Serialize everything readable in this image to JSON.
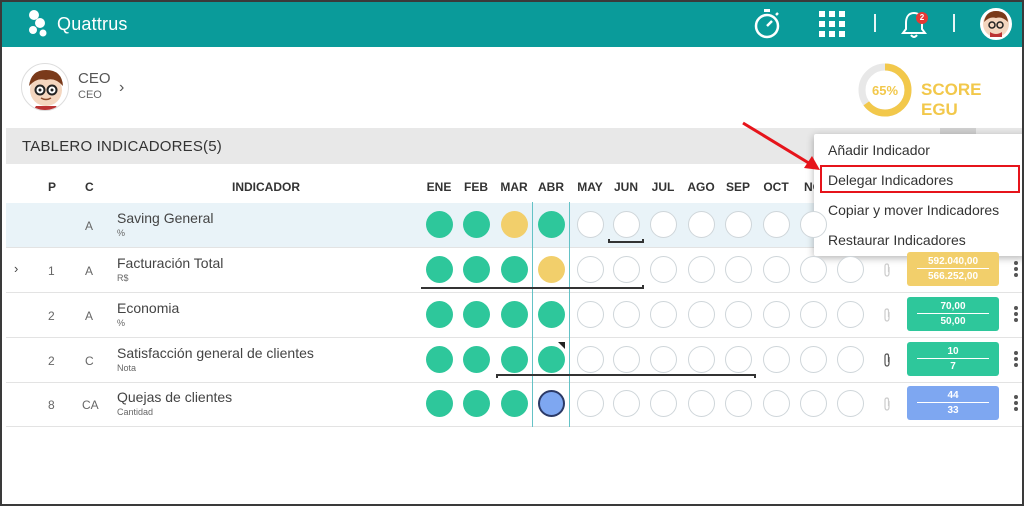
{
  "app": {
    "title": "Quattrus"
  },
  "topbar": {
    "notification_count": "2",
    "icons": [
      "stopwatch-icon",
      "apps-grid-icon",
      "bell-icon",
      "user-avatar"
    ]
  },
  "profile": {
    "name": "CEO",
    "role": "CEO"
  },
  "score": {
    "percent": "65%",
    "label": "SCORE EGU",
    "value": 0.65,
    "color": "#f2c84b"
  },
  "board": {
    "title": "TABLERO INDICADORES(5)",
    "headers": {
      "p": "P",
      "c": "C",
      "indicador": "INDICADOR"
    },
    "months": [
      "ENE",
      "FEB",
      "MAR",
      "ABR",
      "MAY",
      "JUN",
      "JUL",
      "AGO",
      "SEP",
      "OCT",
      "NO"
    ]
  },
  "rows": [
    {
      "p": "",
      "c": "A",
      "name": "Saving General",
      "unit": "%",
      "dots": [
        "green",
        "green",
        "yellow",
        "green",
        "empty",
        "empty",
        "empty",
        "empty",
        "empty",
        "empty",
        "empty"
      ],
      "value1": "",
      "value2": ""
    },
    {
      "p": "1",
      "c": "A",
      "name": "Facturación Total",
      "unit": "R$",
      "dots": [
        "green",
        "green",
        "green",
        "yellow",
        "empty",
        "empty",
        "empty",
        "empty",
        "empty",
        "empty",
        "empty",
        "empty"
      ],
      "value1": "592.040,00",
      "value2": "566.252,00"
    },
    {
      "p": "2",
      "c": "A",
      "name": "Economia",
      "unit": "%",
      "dots": [
        "green",
        "green",
        "green",
        "green",
        "empty",
        "empty",
        "empty",
        "empty",
        "empty",
        "empty",
        "empty",
        "empty"
      ],
      "value1": "70,00",
      "value2": "50,00"
    },
    {
      "p": "2",
      "c": "C",
      "name": "Satisfacción general de clientes",
      "unit": "Nota",
      "dots": [
        "green",
        "green",
        "green",
        "green",
        "empty",
        "empty",
        "empty",
        "empty",
        "empty",
        "empty",
        "empty",
        "empty"
      ],
      "value1": "10",
      "value2": "7"
    },
    {
      "p": "8",
      "c": "CA",
      "name": "Quejas de clientes",
      "unit": "Cantidad",
      "dots": [
        "green",
        "green",
        "green",
        "blue",
        "empty",
        "empty",
        "empty",
        "empty",
        "empty",
        "empty",
        "empty",
        "empty"
      ],
      "value1": "44",
      "value2": "33"
    }
  ],
  "colors": {
    "teal": "#0a9b9a",
    "green": "#2ec79b",
    "yellow": "#f2cf6b",
    "blue": "#7ea7f1",
    "highlight": "#e6141b"
  },
  "menu": {
    "items": [
      "Añadir Indicador",
      "Delegar Indicadores",
      "Copiar y mover Indicadores",
      "Restaurar Indicadores"
    ],
    "highlighted": "Delegar Indicadores"
  }
}
